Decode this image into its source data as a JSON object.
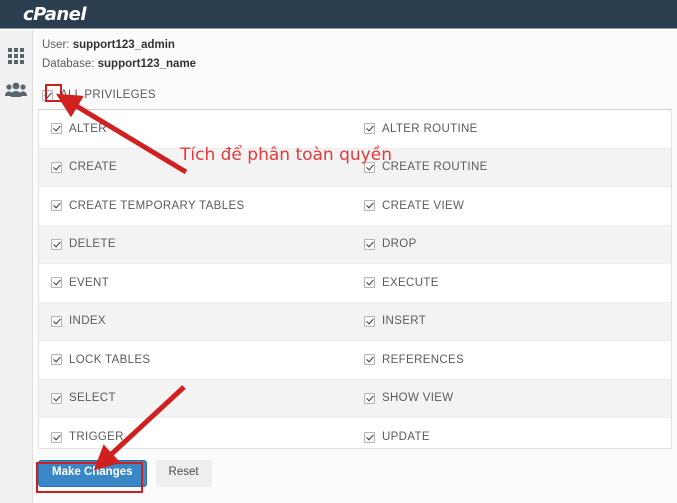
{
  "header": {
    "brand": "cPanel"
  },
  "sidebar": {
    "items": [
      {
        "name": "apps-grid",
        "icon": "grid-icon"
      },
      {
        "name": "users",
        "icon": "users-icon"
      }
    ]
  },
  "database": {
    "user_label": "User:",
    "user_value": "support123_admin",
    "database_label": "Database:",
    "database_value": "support123_name"
  },
  "all_privileges": {
    "label": "ALL PRIVILEGES",
    "checked": true
  },
  "privileges": [
    {
      "left": "ALTER",
      "right": "ALTER ROUTINE"
    },
    {
      "left": "CREATE",
      "right": "CREATE ROUTINE"
    },
    {
      "left": "CREATE TEMPORARY TABLES",
      "right": "CREATE VIEW"
    },
    {
      "left": "DELETE",
      "right": "DROP"
    },
    {
      "left": "EVENT",
      "right": "EXECUTE"
    },
    {
      "left": "INDEX",
      "right": "INSERT"
    },
    {
      "left": "LOCK TABLES",
      "right": "REFERENCES"
    },
    {
      "left": "SELECT",
      "right": "SHOW VIEW"
    },
    {
      "left": "TRIGGER",
      "right": "UPDATE"
    }
  ],
  "actions": {
    "make_changes_label": "Make Changes",
    "reset_label": "Reset"
  },
  "annotation": {
    "text": "Tích để phân toàn quyền",
    "color": "#e23b3b"
  },
  "colors": {
    "header_bg": "#2b3e50",
    "primary_button": "#3a87c8",
    "annotation_red": "#cc1f1f",
    "row_stripe": "#f3f3f3"
  }
}
